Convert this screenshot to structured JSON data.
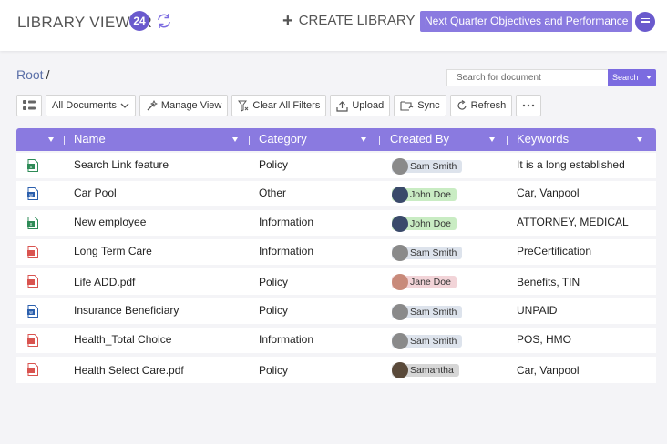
{
  "header": {
    "title": "LIBRARY VIEWER",
    "count": "24",
    "create_label": "CREATE LIBRARY",
    "objectives_label": "Next Quarter Objectives and Performance"
  },
  "breadcrumb": {
    "root": "Root",
    "separator": "/"
  },
  "search": {
    "placeholder": "Search for document",
    "button_label": "Search"
  },
  "toolbar": {
    "view_select": "All Documents",
    "manage_view": "Manage View",
    "clear_filters": "Clear All Filters",
    "upload": "Upload",
    "sync": "Sync",
    "refresh": "Refresh"
  },
  "columns": [
    "Name",
    "Category",
    "Created By",
    "Keywords"
  ],
  "colors": {
    "accent": "#6a5acd",
    "header": "#8a7ae0"
  },
  "rows": [
    {
      "type": "excel",
      "name": "Search Link feature",
      "category": "Policy",
      "created_by": "Sam Smith",
      "keywords": "It is a long established"
    },
    {
      "type": "word",
      "name": "Car Pool",
      "category": "Other",
      "created_by": "John Doe",
      "keywords": "Car, Vanpool"
    },
    {
      "type": "excel",
      "name": "New employee",
      "category": "Information",
      "created_by": "John Doe",
      "keywords": "ATTORNEY, MEDICAL"
    },
    {
      "type": "pdf",
      "name": "Long Term Care",
      "category": "Information",
      "created_by": "Sam Smith",
      "keywords": "PreCertification"
    },
    {
      "type": "pdf",
      "name": "Life ADD.pdf",
      "category": "Policy",
      "created_by": "Jane Doe",
      "keywords": "Benefits, TIN"
    },
    {
      "type": "word",
      "name": "Insurance Beneficiary",
      "category": "Policy",
      "created_by": "Sam Smith",
      "keywords": "UNPAID"
    },
    {
      "type": "pdf",
      "name": "Health_Total Choice",
      "category": "Information",
      "created_by": "Sam Smith",
      "keywords": "POS, HMO"
    },
    {
      "type": "pdf",
      "name": "Health Select Care.pdf",
      "category": "Policy",
      "created_by": "Samantha",
      "keywords": "Car, Vanpool"
    }
  ]
}
